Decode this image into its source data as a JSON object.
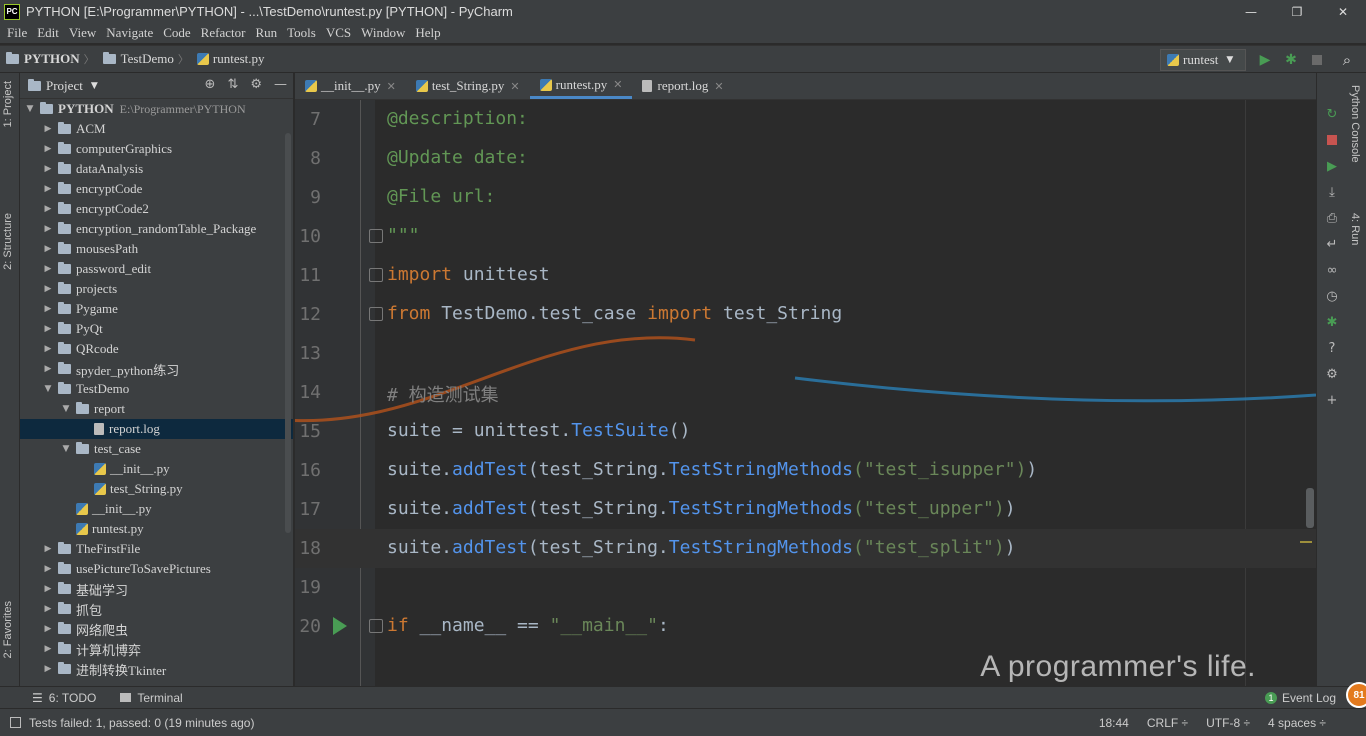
{
  "window": {
    "title": "PYTHON [E:\\Programmer\\PYTHON] - ...\\TestDemo\\runtest.py [PYTHON] - PyCharm",
    "app_badge": "PC",
    "minimize": "—",
    "maximize": "❐",
    "close": "✕"
  },
  "menu": [
    "File",
    "Edit",
    "View",
    "Navigate",
    "Code",
    "Refactor",
    "Run",
    "Tools",
    "VCS",
    "Window",
    "Help"
  ],
  "breadcrumb": [
    "PYTHON",
    "TestDemo",
    "runtest.py"
  ],
  "run_config": "runtest",
  "left_strip": {
    "project_tab": "1: Project",
    "structure_tab": "2: Structure",
    "favorites_tab": "2: Favorites"
  },
  "project_panel": {
    "title": "Project",
    "root": "PYTHON",
    "root_path": "E:\\Programmer\\PYTHON",
    "items": [
      {
        "label": "ACM",
        "level": 1,
        "type": "folder",
        "state": "collapsed"
      },
      {
        "label": "computerGraphics",
        "level": 1,
        "type": "folder",
        "state": "collapsed"
      },
      {
        "label": "dataAnalysis",
        "level": 1,
        "type": "folder",
        "state": "collapsed"
      },
      {
        "label": "encryptCode",
        "level": 1,
        "type": "folder",
        "state": "collapsed"
      },
      {
        "label": "encryptCode2",
        "level": 1,
        "type": "folder",
        "state": "collapsed"
      },
      {
        "label": "encryption_randomTable_Package",
        "level": 1,
        "type": "folder",
        "state": "collapsed"
      },
      {
        "label": "mousesPath",
        "level": 1,
        "type": "folder",
        "state": "collapsed"
      },
      {
        "label": "password_edit",
        "level": 1,
        "type": "folder",
        "state": "collapsed"
      },
      {
        "label": "projects",
        "level": 1,
        "type": "folder",
        "state": "collapsed"
      },
      {
        "label": "Pygame",
        "level": 1,
        "type": "folder",
        "state": "collapsed"
      },
      {
        "label": "PyQt",
        "level": 1,
        "type": "folder",
        "state": "collapsed"
      },
      {
        "label": "QRcode",
        "level": 1,
        "type": "folder",
        "state": "collapsed"
      },
      {
        "label": "spyder_python练习",
        "level": 1,
        "type": "folder",
        "state": "collapsed"
      },
      {
        "label": "TestDemo",
        "level": 1,
        "type": "folder",
        "state": "expanded"
      },
      {
        "label": "report",
        "level": 2,
        "type": "folder",
        "state": "expanded"
      },
      {
        "label": "report.log",
        "level": 3,
        "type": "log",
        "state": "selected"
      },
      {
        "label": "test_case",
        "level": 2,
        "type": "folder",
        "state": "expanded"
      },
      {
        "label": "__init__.py",
        "level": 3,
        "type": "py",
        "state": ""
      },
      {
        "label": "test_String.py",
        "level": 3,
        "type": "py",
        "state": ""
      },
      {
        "label": "__init__.py",
        "level": 2,
        "type": "py",
        "state": ""
      },
      {
        "label": "runtest.py",
        "level": 2,
        "type": "py",
        "state": ""
      },
      {
        "label": "TheFirstFile",
        "level": 1,
        "type": "folder",
        "state": "collapsed"
      },
      {
        "label": "usePictureToSavePictures",
        "level": 1,
        "type": "folder",
        "state": "collapsed"
      },
      {
        "label": "基础学习",
        "level": 1,
        "type": "folder",
        "state": "collapsed"
      },
      {
        "label": "抓包",
        "level": 1,
        "type": "folder",
        "state": "collapsed"
      },
      {
        "label": "网络爬虫",
        "level": 1,
        "type": "folder",
        "state": "collapsed"
      },
      {
        "label": "计算机博弈",
        "level": 1,
        "type": "folder",
        "state": "collapsed"
      },
      {
        "label": "进制转换Tkinter",
        "level": 1,
        "type": "folder",
        "state": "collapsed"
      }
    ]
  },
  "tabs": [
    {
      "label": "__init__.py",
      "icon": "py",
      "active": false
    },
    {
      "label": "test_String.py",
      "icon": "py",
      "active": false
    },
    {
      "label": "runtest.py",
      "icon": "py",
      "active": true
    },
    {
      "label": "report.log",
      "icon": "log",
      "active": false
    }
  ],
  "editor": {
    "lines": [
      {
        "n": "7",
        "text": "@description:"
      },
      {
        "n": "8",
        "text": "@Update date:"
      },
      {
        "n": "9",
        "text": "@File url:"
      },
      {
        "n": "10",
        "text": "\"\"\""
      },
      {
        "n": "11",
        "kw": "import",
        "rest": " unittest"
      },
      {
        "n": "12",
        "kw": "from",
        "mid": " TestDemo.test_case ",
        "kw2": "import",
        "rest": " test_String"
      },
      {
        "n": "13",
        "text": ""
      },
      {
        "n": "14",
        "text": "# 构造测试集"
      },
      {
        "n": "15",
        "a": "suite = unittest.",
        "f": "TestSuite",
        "b": "()"
      },
      {
        "n": "16",
        "a": "suite.",
        "f1": "addTest",
        "b": "(test_String.",
        "f2": "TestStringMethods",
        "s": "(\"test_isupper\")",
        "c": ")"
      },
      {
        "n": "17",
        "a": "suite.",
        "f1": "addTest",
        "b": "(test_String.",
        "f2": "TestStringMethods",
        "s": "(\"test_upper\")",
        "c": ")"
      },
      {
        "n": "18",
        "a": "suite.",
        "f1": "addTest",
        "b": "(test_String.",
        "f2": "TestStringMethods",
        "s": "(\"test_split\")",
        "c": ")"
      },
      {
        "n": "19",
        "text": ""
      },
      {
        "n": "20",
        "kw": "if",
        "mid": " __name__ == ",
        "s": "\"__main__\"",
        "rest": ":"
      }
    ],
    "watermark": "A programmer's life."
  },
  "right_strip": {
    "python_console": "Python Console",
    "run_tab": "4: Run"
  },
  "bottom_tools": {
    "todo": "6: TODO",
    "terminal": "Terminal",
    "event_log": "Event Log",
    "event_count": "1"
  },
  "status": {
    "message": "Tests failed: 1, passed: 0 (19 minutes ago)",
    "position": "18:44",
    "line_sep": "CRLF ÷",
    "encoding": "UTF-8 ÷",
    "indent": "4 spaces ÷",
    "badge": "81"
  },
  "colors": {
    "keyword": "#cc7832",
    "docstring": "#629755",
    "comment": "#808080",
    "function": "#5394ec",
    "string": "#6a8759",
    "selection": "#0d293e",
    "accent": "#4a88c7"
  }
}
